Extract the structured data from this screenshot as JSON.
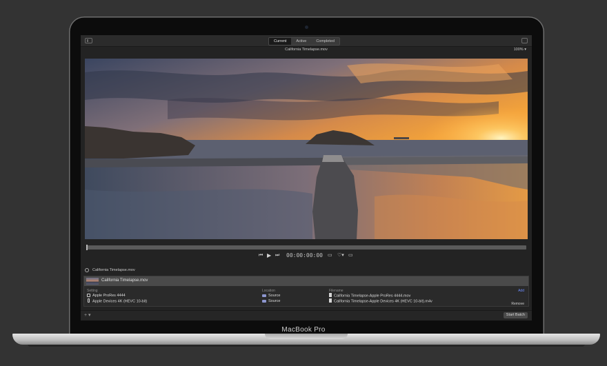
{
  "device": {
    "brand_label": "MacBook Pro"
  },
  "toolbar": {
    "tabs": [
      {
        "label": "Current",
        "active": true
      },
      {
        "label": "Active",
        "active": false
      },
      {
        "label": "Completed",
        "active": false
      }
    ]
  },
  "viewer": {
    "file_title": "California Timelapse.mov",
    "zoom": "100%",
    "timecode": "00:00:00:00"
  },
  "batch": {
    "header_title": "California Timelapse.mov",
    "item_title": "California Timelapse.mov",
    "columns": {
      "setting": "Setting",
      "location": "Location",
      "filename": "Filename"
    },
    "add_label": "Add",
    "remove_label": "Remove",
    "outputs": [
      {
        "setting": "Apple ProRes 4444",
        "location": "Source",
        "filename": "California Timelapse-Apple ProRes 4444.mov",
        "setting_icon": "checkbox-icon"
      },
      {
        "setting": "Apple Devices 4K (HEVC 10-bit)",
        "location": "Source",
        "filename": "California Timelapse-Apple Devices 4K (HEVC 10-bit).m4v",
        "setting_icon": "phone-icon"
      }
    ]
  },
  "footer": {
    "add_symbol": "+",
    "start_label": "Start Batch"
  },
  "colors": {
    "accent": "#6e8dff",
    "folder": "#8d96cf",
    "background": "#333333"
  }
}
